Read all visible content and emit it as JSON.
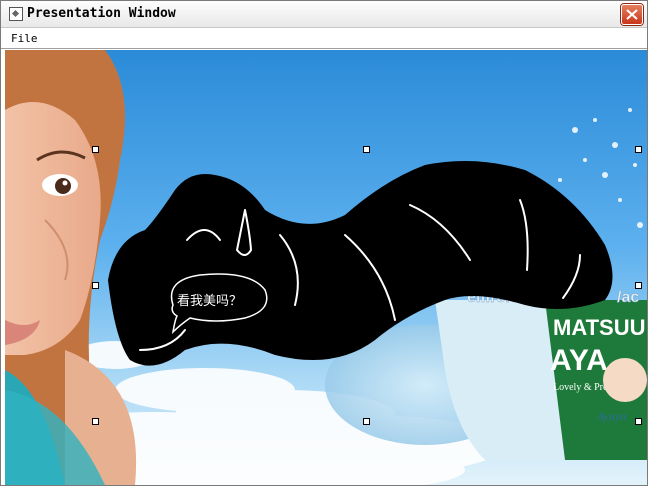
{
  "window": {
    "title": "Presentation Window"
  },
  "menu": {
    "file": "File"
  },
  "canvas": {
    "speech_bubble_text": "看我美吗？",
    "background_watermark": "elfire.c",
    "watermark_tail": "/ac",
    "bottle_text": "MATSUU",
    "bottle_brand": "AYA",
    "bottle_subtext": "Lovely & Pretty",
    "bottle_signature": "Ayaya"
  }
}
